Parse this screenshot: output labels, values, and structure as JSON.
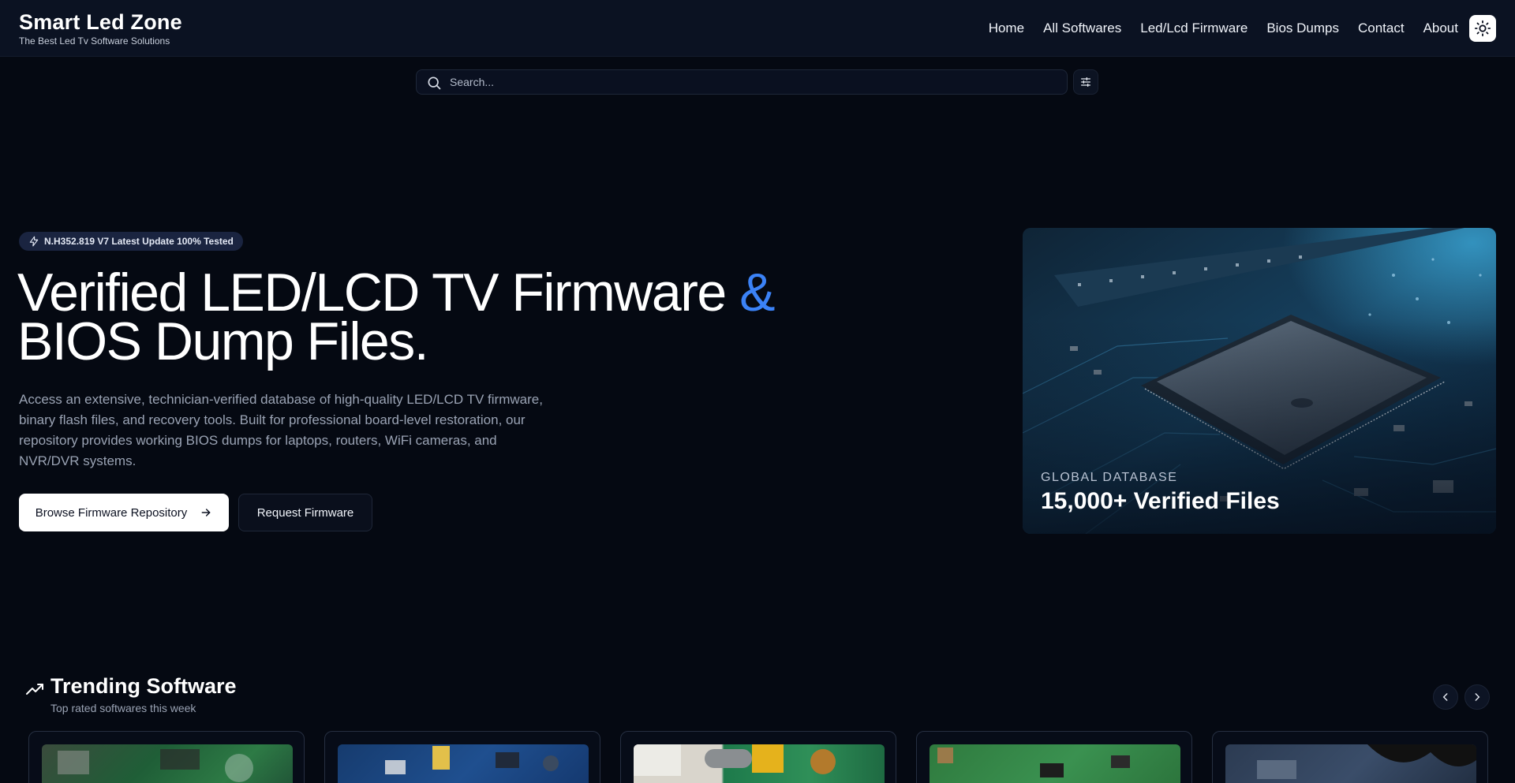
{
  "header": {
    "brand_title": "Smart Led Zone",
    "brand_subtitle": "The Best Led Tv Software Solutions",
    "nav": [
      {
        "label": "Home"
      },
      {
        "label": "All Softwares"
      },
      {
        "label": "Led/Lcd Firmware"
      },
      {
        "label": "Bios Dumps"
      },
      {
        "label": "Contact"
      },
      {
        "label": "About"
      }
    ],
    "theme_icon": "sun-icon"
  },
  "search": {
    "placeholder": "Search...",
    "value": "",
    "icon": "search-icon",
    "filter_icon": "sliders-icon"
  },
  "hero": {
    "badge": "N.H352.819 V7 Latest Update 100% Tested",
    "badge_icon": "lightning-icon",
    "title_line1": "Verified LED/LCD TV Firmware ",
    "title_amp": "&",
    "title_line2": "BIOS Dump Files.",
    "description": "Access an extensive, technician-verified database of high-quality LED/LCD TV firmware, binary flash files, and recovery tools. Built for professional board-level restoration, our repository provides working BIOS dumps for laptops, routers, WiFi cameras, and NVR/DVR systems.",
    "primary_button": "Browse Firmware Repository",
    "secondary_button": "Request Firmware",
    "card_label": "GLOBAL DATABASE",
    "card_value": "15,000+ Verified Files"
  },
  "trending": {
    "title": "Trending Software",
    "subtitle": "Top rated softwares this week",
    "icon": "trending-up-icon",
    "prev_icon": "chevron-left-icon",
    "next_icon": "chevron-right-icon",
    "cards": [
      {
        "thumb": "green-board"
      },
      {
        "thumb": "blue-board"
      },
      {
        "thumb": "power-board"
      },
      {
        "thumb": "green-board"
      },
      {
        "thumb": "dark-board"
      }
    ]
  },
  "colors": {
    "background": "#050912",
    "header": "#0b1222",
    "accent": "#3b82f6",
    "muted_text": "#9aa3b4"
  }
}
